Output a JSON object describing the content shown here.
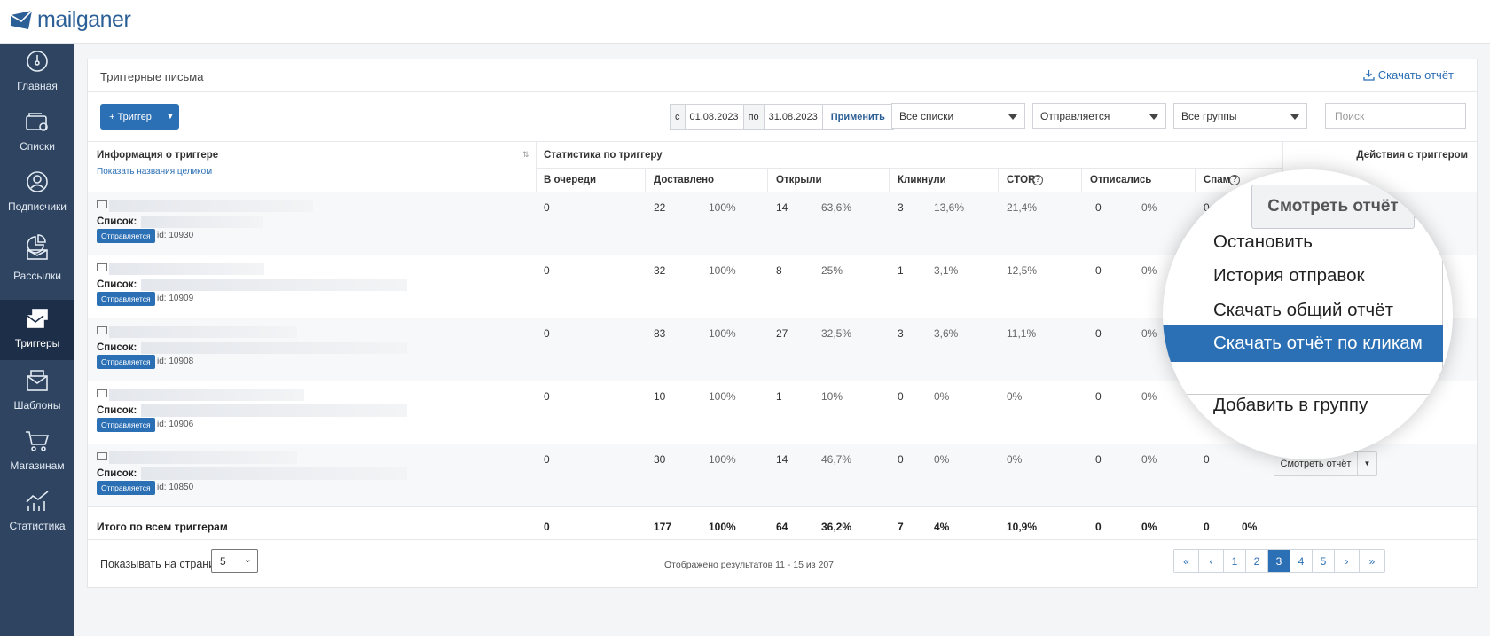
{
  "brand": {
    "name": "mailganer"
  },
  "sidebar": {
    "items": [
      {
        "label": "Главная",
        "icon": "dashboard-icon"
      },
      {
        "label": "Списки",
        "icon": "lists-icon"
      },
      {
        "label": "Подписчики",
        "icon": "subscribers-icon"
      },
      {
        "label": "Рассылки",
        "icon": "mailings-icon"
      },
      {
        "label": "Триггеры",
        "icon": "triggers-icon",
        "active": true
      },
      {
        "label": "Шаблоны",
        "icon": "templates-icon"
      },
      {
        "label": "Магазинам",
        "icon": "shop-cart-icon"
      },
      {
        "label": "Статистика",
        "icon": "stats-icon"
      }
    ]
  },
  "panel": {
    "title": "Триггерные письма",
    "download": "Скачать отчёт"
  },
  "toolbar": {
    "add_label": "+ Триггер",
    "date_from_prefix": "с",
    "date_from": "01.08.2023",
    "date_to_prefix": "по",
    "date_to": "31.08.2023",
    "apply": "Применить",
    "lists_select": "Все списки",
    "status_select": "Отправляется",
    "groups_select": "Все группы",
    "search_placeholder": "Поиск"
  },
  "table": {
    "info_header": "Информация о триггере",
    "show_names": "Показать названия целиком",
    "stats_header": "Статистика по триггеру",
    "actions_header": "Действия с триггером",
    "columns": [
      "В очереди",
      "Доставлено",
      "Открыли",
      "Кликнули",
      "CTOR",
      "Отписались",
      "Спам"
    ],
    "list_label": "Список:",
    "status_badge": "Отправляется",
    "action_label": "Смотреть отчёт",
    "rows": [
      {
        "id": "id: 10930",
        "queue": "0",
        "delivered": "22",
        "delivered_p": "100%",
        "opened": "14",
        "opened_p": "63,6%",
        "clicked": "3",
        "clicked_p": "13,6%",
        "ctor": "21,4%",
        "unsub": "0",
        "unsub_p": "0%",
        "spam": "0"
      },
      {
        "id": "id: 10909",
        "queue": "0",
        "delivered": "32",
        "delivered_p": "100%",
        "opened": "8",
        "opened_p": "25%",
        "clicked": "1",
        "clicked_p": "3,1%",
        "ctor": "12,5%",
        "unsub": "0",
        "unsub_p": "0%",
        "spam": ""
      },
      {
        "id": "id: 10908",
        "queue": "0",
        "delivered": "83",
        "delivered_p": "100%",
        "opened": "27",
        "opened_p": "32,5%",
        "clicked": "3",
        "clicked_p": "3,6%",
        "ctor": "11,1%",
        "unsub": "0",
        "unsub_p": "0%",
        "spam": ""
      },
      {
        "id": "id: 10906",
        "queue": "0",
        "delivered": "10",
        "delivered_p": "100%",
        "opened": "1",
        "opened_p": "10%",
        "clicked": "0",
        "clicked_p": "0%",
        "ctor": "0%",
        "unsub": "0",
        "unsub_p": "0%",
        "spam": ""
      },
      {
        "id": "id: 10850",
        "queue": "0",
        "delivered": "30",
        "delivered_p": "100%",
        "opened": "14",
        "opened_p": "46,7%",
        "clicked": "0",
        "clicked_p": "0%",
        "ctor": "0%",
        "unsub": "0",
        "unsub_p": "0%",
        "spam": "0"
      }
    ],
    "total": {
      "label": "Итого по всем триггерам",
      "queue": "0",
      "delivered": "177",
      "delivered_p": "100%",
      "opened": "64",
      "opened_p": "36,2%",
      "clicked": "7",
      "clicked_p": "4%",
      "ctor": "10,9%",
      "unsub": "0",
      "unsub_p": "0%",
      "spam": "0",
      "spam_p": "0%"
    }
  },
  "footer": {
    "per_page_label": "Показывать на странице",
    "per_page": "5",
    "results": "Отображено результатов 11 - 15 из 207",
    "pages": [
      "«",
      "‹",
      "1",
      "2",
      "3",
      "4",
      "5",
      "›",
      "»"
    ],
    "current": "3"
  },
  "zoom": {
    "button": "Смотреть отчёт",
    "partial": "чёт",
    "menu": [
      "Остановить",
      "История отправок",
      "Скачать общий отчёт",
      "Скачать отчёт по кликам",
      "Добавить в группу"
    ],
    "highlighted": "Скачать отчёт по кликам"
  },
  "colors": {
    "accent": "#2b6fb4",
    "sidebar": "#2e4461",
    "sidebar_active": "#1d2f48"
  }
}
